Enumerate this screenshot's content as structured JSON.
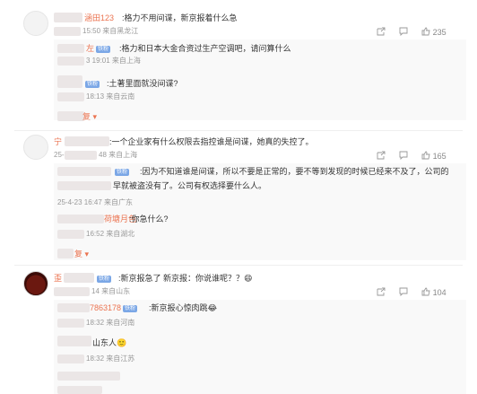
{
  "comments": [
    {
      "name": "涵田123",
      "text": ":格力不用间谍，新京报着什么急",
      "meta": "15:50 来自黑龙江",
      "likes": "235",
      "replies": [
        {
          "name": "左",
          "badge": "铁粉",
          "text": ":格力和日本大金合资过生产空调吧，请问算什么",
          "meta": "3 19:01 来自上海"
        },
        {
          "name": "",
          "badge": "铁粉",
          "text": ":土著里面就没间谍?",
          "meta": "18:13 来自云南"
        }
      ],
      "more": "复"
    },
    {
      "name": "宁",
      "text": ":一个企业家有什么权限去指控谁是间谍，她真的失控了。",
      "meta": "25-",
      "meta2": "48 来自上海",
      "likes": "165",
      "replies": [
        {
          "name": "",
          "badge": "铁粉",
          "text": ":因为不知道谁是间谍，所以不要是正常的，要不等到发现的时候已经来不及了，公司的",
          "text2": "早就被盗没有了。公司有权选择要什么人。",
          "meta": "25-4-23 16:47 来自广东"
        },
        {
          "name": "荷塘月色",
          "text": ":你急什么?",
          "meta": "16:52 来自湖北"
        }
      ],
      "more": "复"
    },
    {
      "name": "歪",
      "badge": "铁粉",
      "text": ":新京报急了 新京报：你说谁呢？？😄",
      "meta": "14 来自山东",
      "likes": "104",
      "replies": [
        {
          "name": "7863178",
          "badge": "铁粉",
          "text": ":新京报心惊肉跳😂",
          "meta": "18:32 来自河南"
        },
        {
          "name": "",
          "text": "山东人🙂",
          "meta": "18:32 来自江苏"
        }
      ]
    }
  ],
  "icons": {
    "share": "share-icon",
    "comment": "comment-icon",
    "like": "thumb-up-icon"
  }
}
